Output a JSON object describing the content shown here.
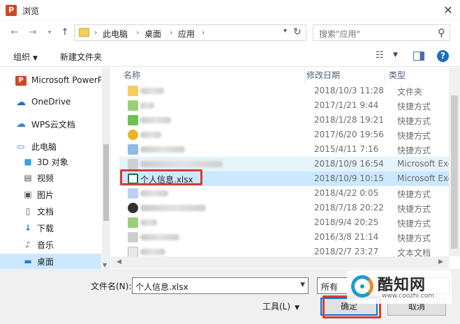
{
  "window": {
    "title": "浏览",
    "app_icon": "P"
  },
  "nav": {
    "back_icon": "back-arrow-icon",
    "forward_icon": "forward-arrow-icon",
    "recent_icon": "chevron-down-icon",
    "up_icon": "up-arrow-icon"
  },
  "address": {
    "crumbs": [
      "此电脑",
      "桌面",
      "应用"
    ]
  },
  "search": {
    "placeholder": "搜索\"应用\""
  },
  "toolbar": {
    "organize_label": "组织",
    "new_folder_label": "新建文件夹"
  },
  "sidebar": {
    "items": [
      {
        "label": "Microsoft PowerP",
        "icon": "powerpoint-icon",
        "color": "#d24726"
      },
      {
        "label": "OneDrive",
        "icon": "cloud-icon",
        "color": "#1c70c7"
      },
      {
        "label": "WPS云文档",
        "icon": "cloud-icon",
        "color": "#3b7fcf"
      },
      {
        "label": "此电脑",
        "icon": "computer-icon",
        "color": "#3c8bd6"
      },
      {
        "label": "3D 对象",
        "icon": "cube-icon",
        "color": "#3aa0e0"
      },
      {
        "label": "视频",
        "icon": "film-icon",
        "color": "#555555"
      },
      {
        "label": "图片",
        "icon": "image-icon",
        "color": "#555555"
      },
      {
        "label": "文档",
        "icon": "document-icon",
        "color": "#555555"
      },
      {
        "label": "下载",
        "icon": "download-arrow-icon",
        "color": "#2a7bd3"
      },
      {
        "label": "音乐",
        "icon": "music-note-icon",
        "color": "#2a7bd3"
      },
      {
        "label": "桌面",
        "icon": "desktop-icon",
        "color": "#2a7bd3"
      }
    ]
  },
  "columns": {
    "name": "名称",
    "date": "修改日期",
    "type": "类型"
  },
  "files": [
    {
      "name": "",
      "date": "2018/10/3 11:28",
      "type": "文件夹",
      "icon_color": "#f4cd5b"
    },
    {
      "name": "",
      "date": "2017/1/21 9:44",
      "type": "快捷方式",
      "icon_color": "#9ad07a"
    },
    {
      "name": "",
      "date": "2018/1/28 19:21",
      "type": "快捷方式",
      "icon_color": "#6cc24a"
    },
    {
      "name": "",
      "date": "2017/6/20 19:56",
      "type": "快捷方式",
      "icon_color": "#e5b52c"
    },
    {
      "name": "",
      "date": "2015/4/11 7:16",
      "type": "快捷方式",
      "icon_color": "#8fb9e6"
    },
    {
      "name": "",
      "date": "2018/10/9 16:54",
      "type": "Microsoft Excel",
      "icon_color": "#cfcfcf"
    },
    {
      "name": "个人信息.xlsx",
      "date": "2018/10/9 10:15",
      "type": "Microsoft Excel",
      "icon_color": "#1e7145"
    },
    {
      "name": "",
      "date": "2018/4/22 0:05",
      "type": "快捷方式",
      "icon_color": "#b7d2f0"
    },
    {
      "name": "",
      "date": "2018/7/18 20:22",
      "type": "快捷方式",
      "icon_color": "#333333"
    },
    {
      "name": "",
      "date": "2018/9/4 20:25",
      "type": "快捷方式",
      "icon_color": "#9ad07a"
    },
    {
      "name": "",
      "date": "2016/3/8 21:14",
      "type": "快捷方式",
      "icon_color": "#cfcfcf"
    },
    {
      "name": "",
      "date": "2018/2/7 23:27",
      "type": "文本文档",
      "icon_color": "#e8e8e8"
    }
  ],
  "bottom": {
    "filename_label": "文件名(N):",
    "filename_value": "个人信息.xlsx",
    "filter_value": "所有",
    "tools_label": "工具(L)",
    "ok_label": "确定",
    "cancel_label": "取消"
  },
  "watermark": {
    "text": "酷知网",
    "url": "www.coozhi.com"
  },
  "colors": {
    "selection": "#cce8ff",
    "hover": "#e5f3fb",
    "highlight_box": "#d63a3a",
    "accent": "#0078d7"
  }
}
